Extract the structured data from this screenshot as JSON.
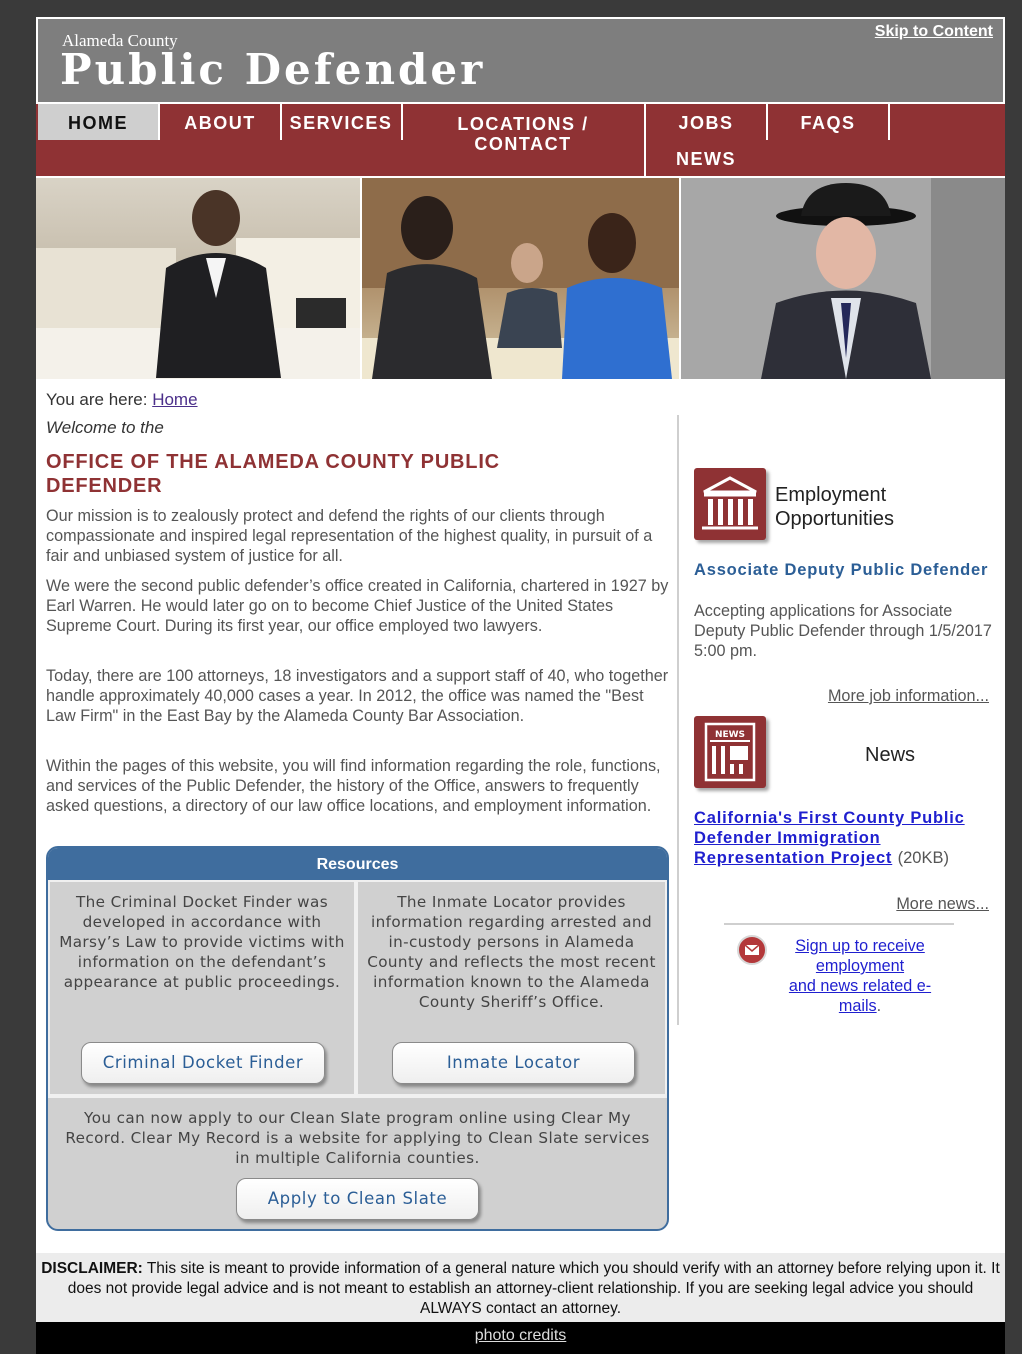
{
  "header": {
    "county": "Alameda County",
    "agency": "Public Defender",
    "skip_link": "Skip to Content"
  },
  "nav": {
    "items": [
      {
        "label": "HOME"
      },
      {
        "label": "ABOUT"
      },
      {
        "label": "SERVICES"
      },
      {
        "label": "LOCATIONS /",
        "label2": "CONTACT"
      },
      {
        "label": "JOBS"
      },
      {
        "label": "FAQS"
      },
      {
        "label": "NEWS"
      }
    ]
  },
  "breadcrumb": {
    "prefix": "You are here:",
    "home_link": "Home"
  },
  "main": {
    "welcome": "Welcome to the",
    "title": "OFFICE OF THE ALAMEDA COUNTY PUBLIC DEFENDER",
    "paragraphs": [
      "Our mission is to zealously protect and defend the rights of our clients through compassionate and inspired legal representation of the highest quality, in pursuit of a fair and unbiased system of justice for all.",
      "We were the second public defender’s office created in California, chartered in 1927 by Earl Warren. He would later go on to become Chief Justice of the United States Supreme Court. During its first year, our office employed two lawyers.",
      "Today, there are 100 attorneys, 18 investigators and a support staff of 40, who together handle approximately 40,000 cases a year. In 2012, the office was named the \"Best Law Firm\" in the East Bay by the Alameda County Bar Association.",
      "Within the pages of this website, you will find information regarding the role, functions, and services of the Public Defender, the history of the Office, answers to frequently asked questions, a directory of our law office locations, and employment information."
    ]
  },
  "resources": {
    "heading": "Resources",
    "docket_text": "The Criminal Docket Finder was developed in accordance with Marsy’s Law to provide victims with information on the defendant’s appearance at public proceedings.",
    "docket_button": "Criminal Docket Finder",
    "inmate_text": "The Inmate Locator provides information regarding arrested and in-custody persons in Alameda County and reflects the most recent information known to the Alameda County Sheriff’s Office.",
    "inmate_button": "Inmate Locator",
    "clean_slate_text": "You can now apply to our Clean Slate program online using Clear My Record. Clear My Record is a website for applying to Clean Slate services in multiple California counties.",
    "clean_slate_button": "Apply to Clean Slate"
  },
  "sidebar": {
    "employment_heading_1": "Employment",
    "employment_heading_2": "Opportunities",
    "job_title": "Associate Deputy Public Defender",
    "job_desc": "Accepting applications for Associate Deputy Public Defender through 1/5/2017 5:00 pm.",
    "more_jobs": "More job information...",
    "news_heading": "News",
    "news_icon_label": "NEWS",
    "news_link": "California's First County Public Defender Immigration Representation Project",
    "news_size": "(20KB)",
    "more_news": "More news...",
    "signup_link_1": "Sign up to receive employment",
    "signup_link_2": "and news related e-mails",
    "signup_suffix": "."
  },
  "footer": {
    "disclaimer_label": "DISCLAIMER:",
    "disclaimer_text": "This site is meant to provide information of a general nature which you should verify with an attorney before relying upon it. It does not provide legal advice and is not meant to establish an attorney-client relationship. If you are seeking legal advice you should ALWAYS contact an attorney.",
    "photo_credits": "photo credits"
  },
  "colors": {
    "brand_red": "#8f3234",
    "header_gray": "#7e7e7e",
    "resources_blue": "#3f6d9e",
    "link_blue": "#1f1fcf",
    "job_blue": "#2b5e96"
  }
}
